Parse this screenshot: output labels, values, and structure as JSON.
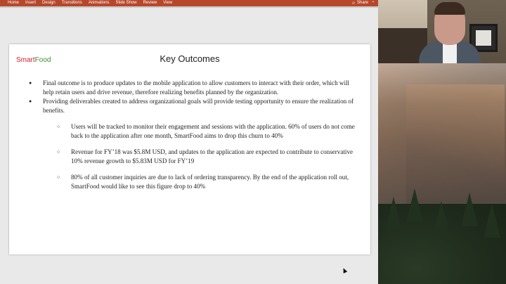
{
  "ribbon": {
    "tabs": [
      "Home",
      "Insert",
      "Design",
      "Transitions",
      "Animations",
      "Slide Show",
      "Review",
      "View"
    ],
    "share_label": "Share",
    "color": "#b7472a"
  },
  "slide": {
    "logo_smart": "Smart",
    "logo_food": "Food",
    "title": "Key Outcomes",
    "bullets": [
      "Final outcome is to produce updates to the mobile application to allow customers to interact with their order, which will help retain users and drive revenue, therefore realizing benefits planned by the organization.",
      "Providing deliverables created to address organizational goals will provide testing opportunity to ensure the realization of benefits."
    ],
    "sub_bullets": [
      "Users will be tracked to monitor their engagement and sessions with the application. 60% of users do not come back to the application after one month, SmartFood aims to drop this churn to 40%",
      "Revenue for FY’18 was $5.8M USD, and updates to the application are expected to contribute to conservative 10% revenue growth to $5.83M USD for FY’19",
      "80% of all customer inquiries are due to lack of ordering transparency. By the end of the application roll out, SmartFood would like to see this figure drop to 40%"
    ]
  },
  "icons": {
    "share": "person-icon",
    "collapse": "chevron-up-icon"
  }
}
